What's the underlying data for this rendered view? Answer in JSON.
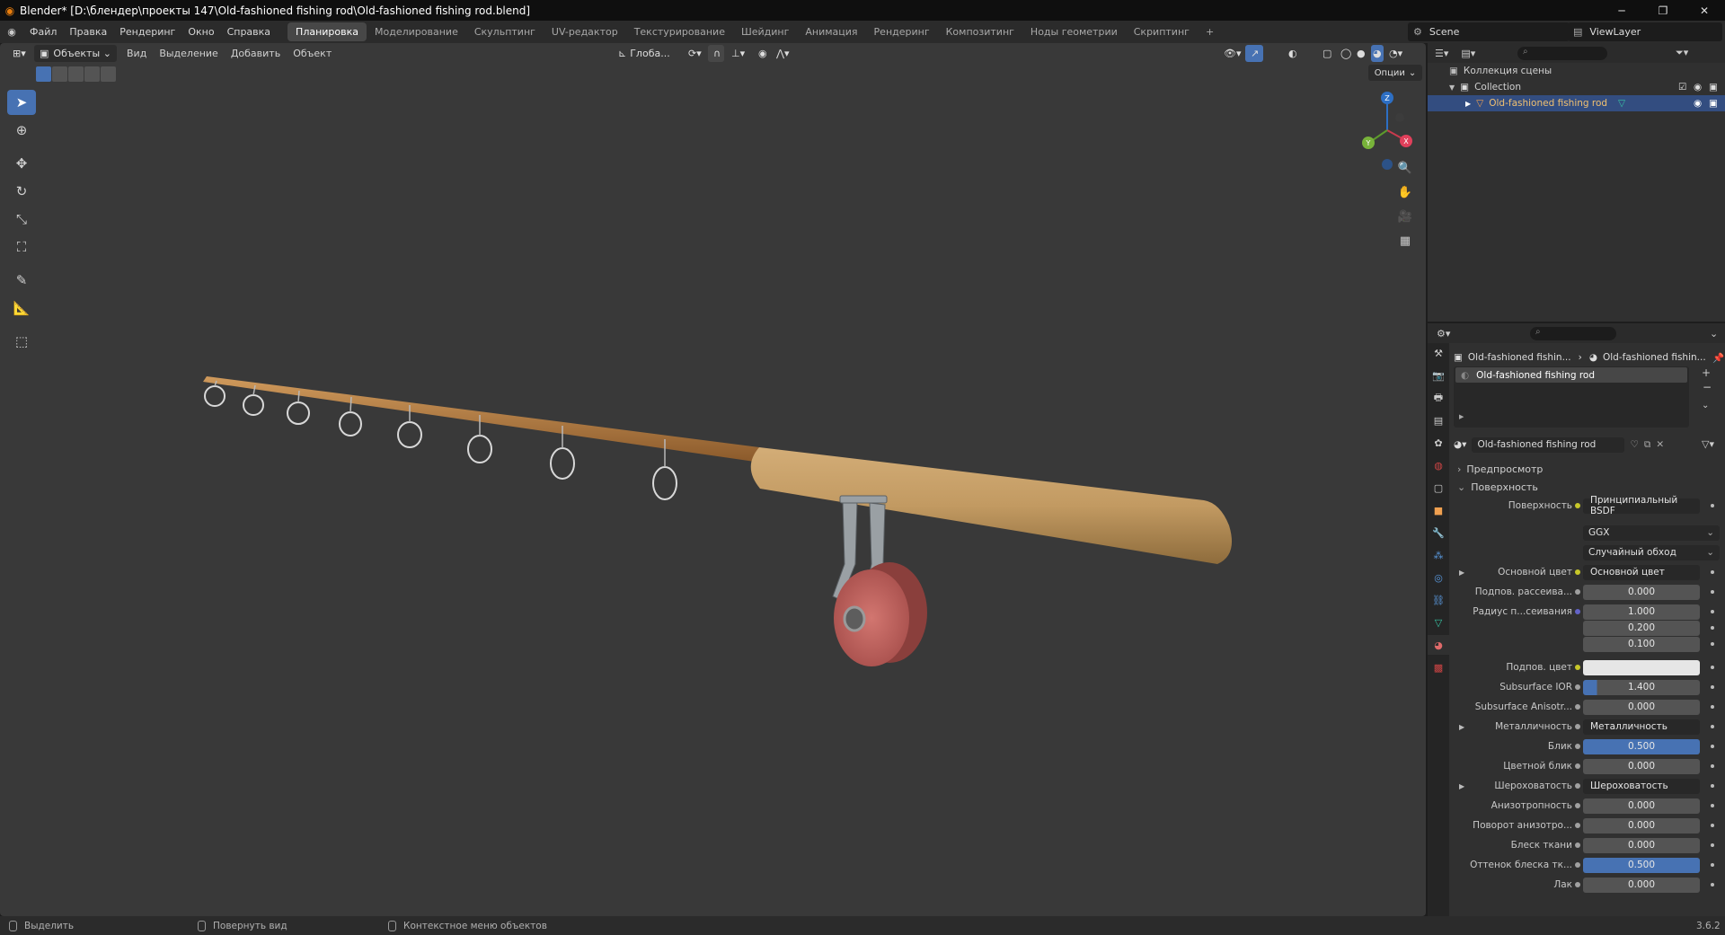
{
  "titlebar": {
    "title": "Blender* [D:\\блендер\\проекты 147\\Old-fashioned fishing rod\\Old-fashioned fishing rod.blend]"
  },
  "menubar": {
    "menus": [
      "Файл",
      "Правка",
      "Рендеринг",
      "Окно",
      "Справка"
    ],
    "workspaces": [
      "Планировка",
      "Моделирование",
      "Скульптинг",
      "UV-редактор",
      "Текстурирование",
      "Шейдинг",
      "Анимация",
      "Рендеринг",
      "Композитинг",
      "Ноды геометрии",
      "Скриптинг"
    ],
    "active_workspace": "Планировка",
    "add_tab": "+",
    "scene": "Scene",
    "view_layer": "ViewLayer"
  },
  "viewport_header": {
    "mode": "Объекты",
    "menus": [
      "Вид",
      "Выделение",
      "Добавить",
      "Объект"
    ],
    "transform_orientation": "Глоба...",
    "options": "Опции"
  },
  "gizmo": {
    "x": "X",
    "y": "Y",
    "z": "Z"
  },
  "outliner": {
    "scene_collection": "Коллекция сцены",
    "collection": "Collection",
    "object": "Old-fashioned fishing rod"
  },
  "properties": {
    "breadcrumb_object": "Old-fashioned fishin...",
    "breadcrumb_material": "Old-fashioned fishin...",
    "material_slot": "Old-fashioned fishing rod",
    "material_name": "Old-fashioned fishing rod",
    "preview_section": "Предпросмотр",
    "surface_section": "Поверхность",
    "rows": [
      {
        "label": "Поверхность",
        "value": "Принципиальный BSDF",
        "kind": "link",
        "dot": "y"
      },
      {
        "label": "",
        "value": "GGX",
        "kind": "dropdown"
      },
      {
        "label": "",
        "value": "Случайный обход",
        "kind": "dropdown"
      },
      {
        "label": "Основной цвет",
        "value": "Основной цвет",
        "kind": "link",
        "dot": "y",
        "expand": true
      },
      {
        "label": "Подпов. рассеива...",
        "value": "0.000",
        "kind": "num",
        "dot": "g"
      },
      {
        "label": "Радиус п...сеивания",
        "value": "1.000",
        "kind": "num",
        "dot": "b"
      },
      {
        "label": "",
        "value": "0.200",
        "kind": "num"
      },
      {
        "label": "",
        "value": "0.100",
        "kind": "num"
      },
      {
        "label": "Подпов. цвет",
        "value": "",
        "kind": "color",
        "dot": "y"
      },
      {
        "label": "Subsurface IOR",
        "value": "1.400",
        "kind": "numhalf",
        "dot": "g"
      },
      {
        "label": "Subsurface Anisotr...",
        "value": "0.000",
        "kind": "num",
        "dot": "g"
      },
      {
        "label": "Металличность",
        "value": "Металличность",
        "kind": "link",
        "dot": "g",
        "expand": true
      },
      {
        "label": "Блик",
        "value": "0.500",
        "kind": "numblue",
        "dot": "g"
      },
      {
        "label": "Цветной блик",
        "value": "0.000",
        "kind": "num",
        "dot": "g"
      },
      {
        "label": "Шероховатость",
        "value": "Шероховатость",
        "kind": "link",
        "dot": "g",
        "expand": true
      },
      {
        "label": "Анизотропность",
        "value": "0.000",
        "kind": "num",
        "dot": "g"
      },
      {
        "label": "Поворот анизотро...",
        "value": "0.000",
        "kind": "num",
        "dot": "g"
      },
      {
        "label": "Блеск ткани",
        "value": "0.000",
        "kind": "num",
        "dot": "g"
      },
      {
        "label": "Оттенок блеска тк...",
        "value": "0.500",
        "kind": "numblue",
        "dot": "g"
      },
      {
        "label": "Лак",
        "value": "0.000",
        "kind": "num",
        "dot": "g"
      }
    ]
  },
  "statusbar": {
    "select": "Выделить",
    "rotate": "Повернуть вид",
    "context": "Контекстное меню объектов",
    "version": "3.6.2"
  },
  "colors": {
    "accent": "#4772b3",
    "selection": "#334d80",
    "viewport_bg": "#393939",
    "cork": "#c29a62",
    "reel": "#c4625e"
  }
}
